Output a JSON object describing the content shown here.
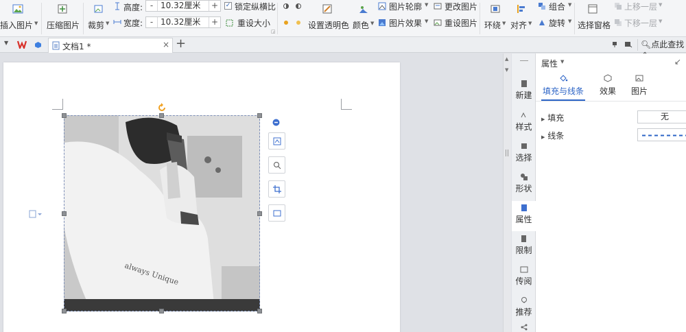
{
  "ribbon": {
    "insert_picture": "插入图片",
    "compress_picture": "压缩图片",
    "crop": "裁剪",
    "height_label": "高度:",
    "height_value": "10.32厘米",
    "width_label": "宽度:",
    "width_value": "10.32厘米",
    "minus": "-",
    "plus": "+",
    "lock_ratio": "锁定纵横比",
    "reset_size": "重设大小",
    "set_transparent": "设置透明色",
    "color": "颜色",
    "picture_outline": "图片轮廓",
    "picture_effect": "图片效果",
    "change_picture": "更改图片",
    "reset_picture": "重设图片",
    "wrap": "环绕",
    "align": "对齐",
    "group": "组合",
    "rotate": "旋转",
    "selection_pane": "选择窗格",
    "bring_forward": "上移一层",
    "send_backward": "下移一层"
  },
  "tabs": {
    "doc_title": "文档1 *",
    "close": "×",
    "new_tab": "+"
  },
  "search": {
    "placeholder": "点此查找命"
  },
  "sidebar": {
    "items": [
      {
        "label": "新建"
      },
      {
        "label": "样式"
      },
      {
        "label": "选择"
      },
      {
        "label": "形状"
      },
      {
        "label": "属性"
      },
      {
        "label": "限制"
      },
      {
        "label": "传阅"
      },
      {
        "label": "推荐"
      }
    ]
  },
  "props": {
    "title": "属性",
    "tabs": [
      {
        "label": "填充与线条"
      },
      {
        "label": "效果"
      },
      {
        "label": "图片"
      }
    ],
    "fill_label": "填充",
    "fill_value": "无",
    "line_label": "线条"
  },
  "photo": {
    "shirt_text": "always Unique"
  },
  "colors": {
    "accent": "#2c64c6",
    "selection": "#7d8fb8",
    "rotate_handle": "#f0a020"
  }
}
